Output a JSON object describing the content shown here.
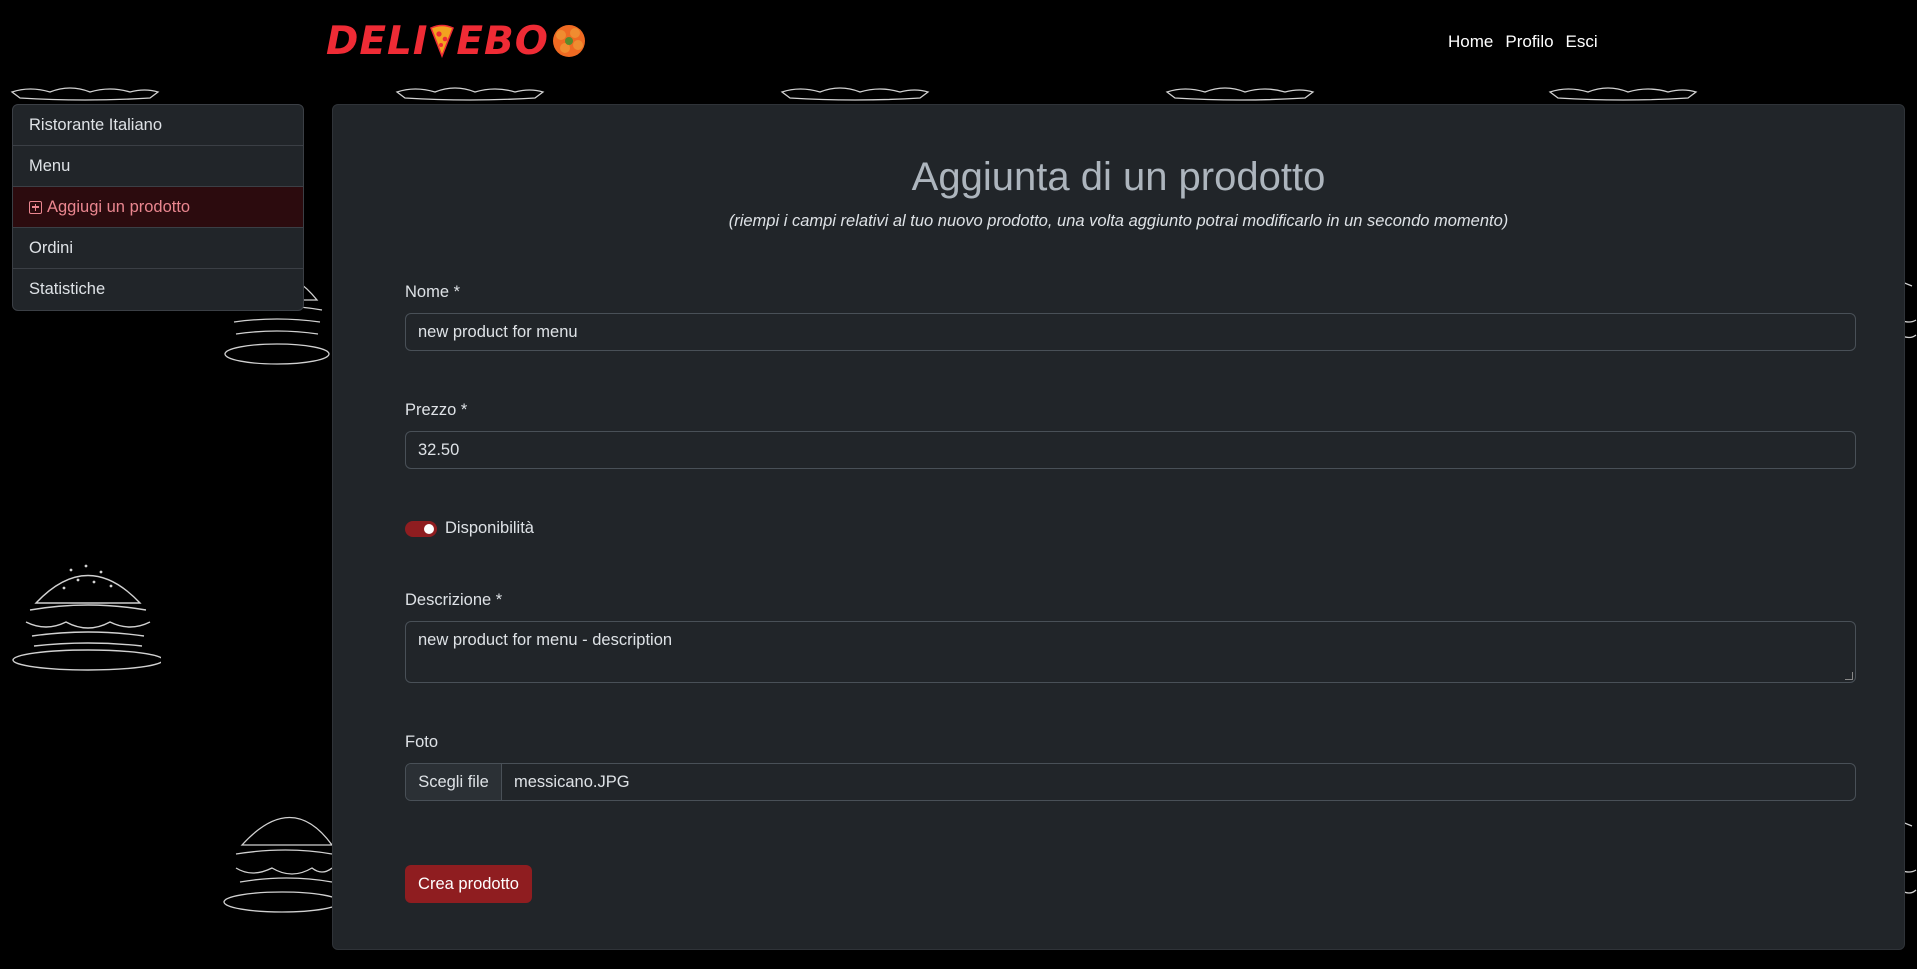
{
  "brand": {
    "logo_part1": "DELI",
    "logo_part2": "EBO",
    "accent_color": "#ef2b35"
  },
  "nav": {
    "items": [
      {
        "label": "Home"
      },
      {
        "label": "Profilo"
      },
      {
        "label": "Esci"
      }
    ]
  },
  "sidebar": {
    "items": [
      {
        "label": "Ristorante Italiano",
        "active": false
      },
      {
        "label": "Menu",
        "active": false
      },
      {
        "label": "Aggiugi un prodotto",
        "active": true,
        "icon": "plus-square-icon"
      },
      {
        "label": "Ordini",
        "active": false
      },
      {
        "label": "Statistiche",
        "active": false
      }
    ]
  },
  "form": {
    "title": "Aggiunta di un prodotto",
    "subtitle": "(riempi i campi relativi al tuo nuovo prodotto, una volta aggiunto potrai modificarlo in un secondo momento)",
    "name": {
      "label": "Nome *",
      "value": "new product for menu"
    },
    "price": {
      "label": "Prezzo *",
      "value": "32.50"
    },
    "availability": {
      "label": "Disponibilità",
      "checked": true
    },
    "description": {
      "label": "Descrizione *",
      "value": "new product for menu - description"
    },
    "photo": {
      "label": "Foto",
      "button_label": "Scegli file",
      "file_name": "messicano.JPG"
    },
    "submit_label": "Crea prodotto",
    "button_color": "#8f1d20"
  }
}
